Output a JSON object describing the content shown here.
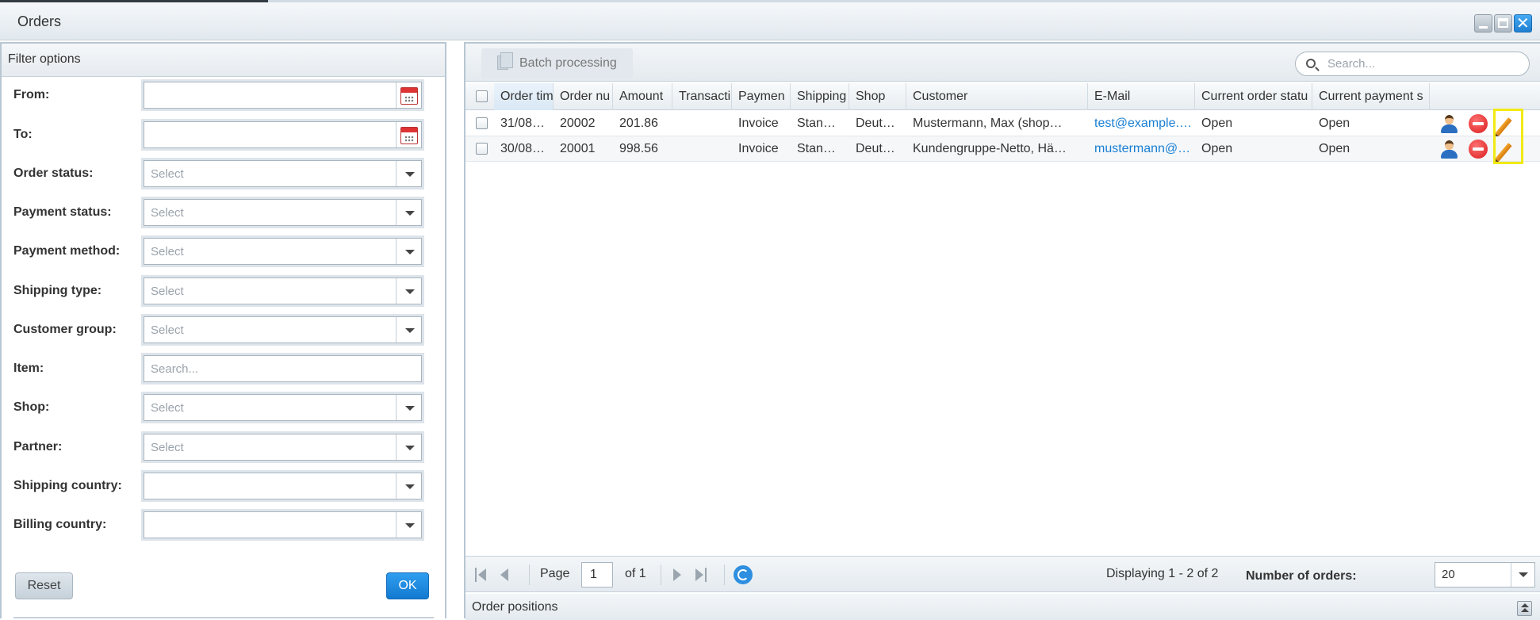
{
  "window": {
    "title": "Orders"
  },
  "filter": {
    "header": "Filter options",
    "fields": [
      {
        "label": "From:",
        "placeholder": "",
        "kind": "date"
      },
      {
        "label": "To:",
        "placeholder": "",
        "kind": "date"
      },
      {
        "label": "Order status:",
        "placeholder": "Select",
        "kind": "combo"
      },
      {
        "label": "Payment status:",
        "placeholder": "Select",
        "kind": "combo"
      },
      {
        "label": "Payment method:",
        "placeholder": "Select",
        "kind": "combo"
      },
      {
        "label": "Shipping type:",
        "placeholder": "Select",
        "kind": "combo"
      },
      {
        "label": "Customer group:",
        "placeholder": "Select",
        "kind": "combo"
      },
      {
        "label": "Item:",
        "placeholder": "Search...",
        "kind": "text"
      },
      {
        "label": "Shop:",
        "placeholder": "Select",
        "kind": "combo"
      },
      {
        "label": "Partner:",
        "placeholder": "Select",
        "kind": "combo"
      },
      {
        "label": "Shipping country:",
        "placeholder": "",
        "kind": "combo"
      },
      {
        "label": "Billing country:",
        "placeholder": "",
        "kind": "combo"
      }
    ],
    "reset_label": "Reset",
    "ok_label": "OK"
  },
  "toolbar": {
    "batch_label": "Batch processing",
    "search_placeholder": "Search..."
  },
  "grid": {
    "columns": [
      "Order tim",
      "Order nu",
      "Amount",
      "Transacti",
      "Paymen",
      "Shipping",
      "Shop",
      "Customer",
      "E-Mail",
      "Current order statu",
      "Current payment s"
    ],
    "rows": [
      [
        "31/08…",
        "20002",
        "201.86",
        "",
        "Invoice",
        "Stan…",
        "Deut…",
        "Mustermann, Max (shop…",
        "test@example.…",
        "Open",
        "Open"
      ],
      [
        "30/08…",
        "20001",
        "998.56",
        "",
        "Invoice",
        "Stan…",
        "Deut…",
        "Kundengruppe-Netto, Hä…",
        "mustermann@…",
        "Open",
        "Open"
      ]
    ]
  },
  "pager": {
    "page_label": "Page",
    "page_value": "1",
    "of_label": "of 1",
    "display_text": "Displaying 1 - 2 of 2",
    "num_orders_label": "Number of orders:",
    "num_orders_value": "20"
  },
  "positions": {
    "label": "Order positions"
  }
}
